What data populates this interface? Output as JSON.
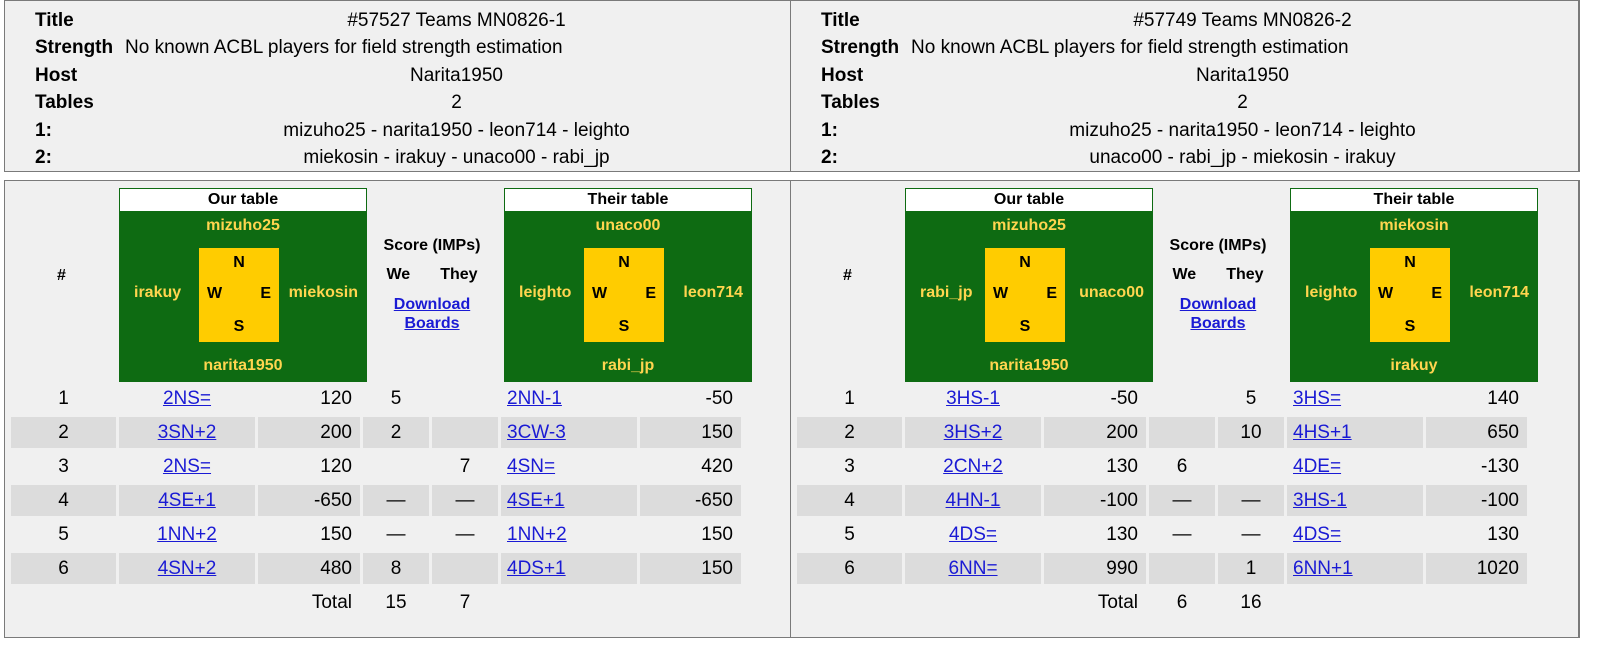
{
  "panels": [
    {
      "title": "#57527 Teams MN0826-1",
      "strength": "No known ACBL players for field strength estimation",
      "host": "Narita1950",
      "tables": "2",
      "table1": "mizuho25 - narita1950 - leon714 - leighto",
      "table2": "miekosin - irakuy - unaco00 - rabi_jp",
      "our_table": {
        "north": "mizuho25",
        "west": "irakuy",
        "east": "miekosin",
        "south": "narita1950"
      },
      "their_table": {
        "north": "unaco00",
        "west": "leighto",
        "east": "leon714",
        "south": "rabi_jp"
      },
      "total": {
        "we": "15",
        "they": "7"
      },
      "rows": [
        {
          "n": "1",
          "our": "2NS=",
          "our_score": "120",
          "we": "5",
          "they": "",
          "their": "2NN-1",
          "their_score": "-50"
        },
        {
          "n": "2",
          "our": "3SN+2",
          "our_score": "200",
          "we": "2",
          "they": "",
          "their": "3CW-3",
          "their_score": "150"
        },
        {
          "n": "3",
          "our": "2NS=",
          "our_score": "120",
          "we": "",
          "they": "7",
          "their": "4SN=",
          "their_score": "420"
        },
        {
          "n": "4",
          "our": "4SE+1",
          "our_score": "-650",
          "we": "—",
          "they": "—",
          "their": "4SE+1",
          "their_score": "-650"
        },
        {
          "n": "5",
          "our": "1NN+2",
          "our_score": "150",
          "we": "—",
          "they": "—",
          "their": "1NN+2",
          "their_score": "150"
        },
        {
          "n": "6",
          "our": "4SN+2",
          "our_score": "480",
          "we": "8",
          "they": "",
          "their": "4DS+1",
          "their_score": "150"
        }
      ]
    },
    {
      "title": "#57749 Teams MN0826-2",
      "strength": "No known ACBL players for field strength estimation",
      "host": "Narita1950",
      "tables": "2",
      "table1": "mizuho25 - narita1950 - leon714 - leighto",
      "table2": "unaco00 - rabi_jp - miekosin - irakuy",
      "our_table": {
        "north": "mizuho25",
        "west": "rabi_jp",
        "east": "unaco00",
        "south": "narita1950"
      },
      "their_table": {
        "north": "miekosin",
        "west": "leighto",
        "east": "leon714",
        "south": "irakuy"
      },
      "total": {
        "we": "6",
        "they": "16"
      },
      "rows": [
        {
          "n": "1",
          "our": "3HS-1",
          "our_score": "-50",
          "we": "",
          "they": "5",
          "their": "3HS=",
          "their_score": "140"
        },
        {
          "n": "2",
          "our": "3HS+2",
          "our_score": "200",
          "we": "",
          "they": "10",
          "their": "4HS+1",
          "their_score": "650"
        },
        {
          "n": "3",
          "our": "2CN+2",
          "our_score": "130",
          "we": "6",
          "they": "",
          "their": "4DE=",
          "their_score": "-130"
        },
        {
          "n": "4",
          "our": "4HN-1",
          "our_score": "-100",
          "we": "—",
          "they": "—",
          "their": "3HS-1",
          "their_score": "-100"
        },
        {
          "n": "5",
          "our": "4DS=",
          "our_score": "130",
          "we": "—",
          "they": "—",
          "their": "4DS=",
          "their_score": "130"
        },
        {
          "n": "6",
          "our": "6NN=",
          "our_score": "990",
          "we": "",
          "they": "1",
          "their": "6NN+1",
          "their_score": "1020"
        }
      ]
    }
  ],
  "labels": {
    "title": "Title",
    "strength": "Strength",
    "host": "Host",
    "tables": "Tables",
    "t1": "1:",
    "t2": "2:",
    "hash": "#",
    "our_table": "Our table",
    "their_table": "Their table",
    "score": "Score (IMPs)",
    "we": "We",
    "they": "They",
    "download": "Download Boards",
    "total": "Total",
    "n": "N",
    "s": "S",
    "w": "W",
    "e": "E"
  }
}
